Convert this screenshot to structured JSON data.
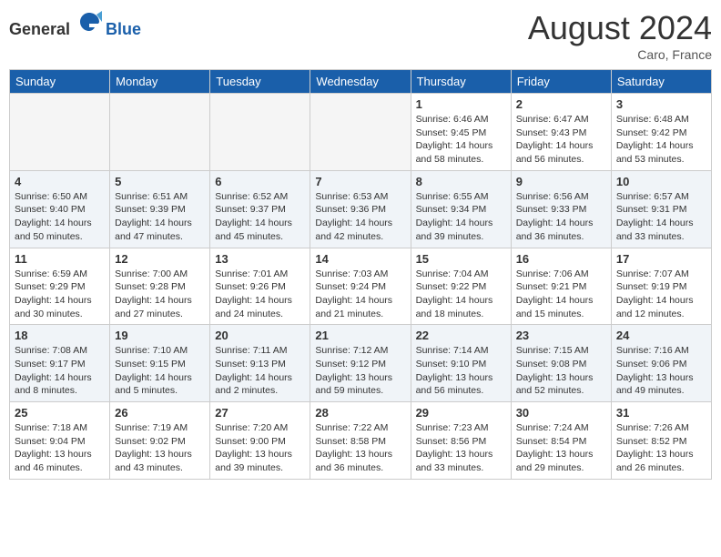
{
  "header": {
    "logo_general": "General",
    "logo_blue": "Blue",
    "month_year": "August 2024",
    "location": "Caro, France"
  },
  "days_of_week": [
    "Sunday",
    "Monday",
    "Tuesday",
    "Wednesday",
    "Thursday",
    "Friday",
    "Saturday"
  ],
  "weeks": [
    [
      {
        "day": "",
        "info": ""
      },
      {
        "day": "",
        "info": ""
      },
      {
        "day": "",
        "info": ""
      },
      {
        "day": "",
        "info": ""
      },
      {
        "day": "1",
        "info": "Sunrise: 6:46 AM\nSunset: 9:45 PM\nDaylight: 14 hours\nand 58 minutes."
      },
      {
        "day": "2",
        "info": "Sunrise: 6:47 AM\nSunset: 9:43 PM\nDaylight: 14 hours\nand 56 minutes."
      },
      {
        "day": "3",
        "info": "Sunrise: 6:48 AM\nSunset: 9:42 PM\nDaylight: 14 hours\nand 53 minutes."
      }
    ],
    [
      {
        "day": "4",
        "info": "Sunrise: 6:50 AM\nSunset: 9:40 PM\nDaylight: 14 hours\nand 50 minutes."
      },
      {
        "day": "5",
        "info": "Sunrise: 6:51 AM\nSunset: 9:39 PM\nDaylight: 14 hours\nand 47 minutes."
      },
      {
        "day": "6",
        "info": "Sunrise: 6:52 AM\nSunset: 9:37 PM\nDaylight: 14 hours\nand 45 minutes."
      },
      {
        "day": "7",
        "info": "Sunrise: 6:53 AM\nSunset: 9:36 PM\nDaylight: 14 hours\nand 42 minutes."
      },
      {
        "day": "8",
        "info": "Sunrise: 6:55 AM\nSunset: 9:34 PM\nDaylight: 14 hours\nand 39 minutes."
      },
      {
        "day": "9",
        "info": "Sunrise: 6:56 AM\nSunset: 9:33 PM\nDaylight: 14 hours\nand 36 minutes."
      },
      {
        "day": "10",
        "info": "Sunrise: 6:57 AM\nSunset: 9:31 PM\nDaylight: 14 hours\nand 33 minutes."
      }
    ],
    [
      {
        "day": "11",
        "info": "Sunrise: 6:59 AM\nSunset: 9:29 PM\nDaylight: 14 hours\nand 30 minutes."
      },
      {
        "day": "12",
        "info": "Sunrise: 7:00 AM\nSunset: 9:28 PM\nDaylight: 14 hours\nand 27 minutes."
      },
      {
        "day": "13",
        "info": "Sunrise: 7:01 AM\nSunset: 9:26 PM\nDaylight: 14 hours\nand 24 minutes."
      },
      {
        "day": "14",
        "info": "Sunrise: 7:03 AM\nSunset: 9:24 PM\nDaylight: 14 hours\nand 21 minutes."
      },
      {
        "day": "15",
        "info": "Sunrise: 7:04 AM\nSunset: 9:22 PM\nDaylight: 14 hours\nand 18 minutes."
      },
      {
        "day": "16",
        "info": "Sunrise: 7:06 AM\nSunset: 9:21 PM\nDaylight: 14 hours\nand 15 minutes."
      },
      {
        "day": "17",
        "info": "Sunrise: 7:07 AM\nSunset: 9:19 PM\nDaylight: 14 hours\nand 12 minutes."
      }
    ],
    [
      {
        "day": "18",
        "info": "Sunrise: 7:08 AM\nSunset: 9:17 PM\nDaylight: 14 hours\nand 8 minutes."
      },
      {
        "day": "19",
        "info": "Sunrise: 7:10 AM\nSunset: 9:15 PM\nDaylight: 14 hours\nand 5 minutes."
      },
      {
        "day": "20",
        "info": "Sunrise: 7:11 AM\nSunset: 9:13 PM\nDaylight: 14 hours\nand 2 minutes."
      },
      {
        "day": "21",
        "info": "Sunrise: 7:12 AM\nSunset: 9:12 PM\nDaylight: 13 hours\nand 59 minutes."
      },
      {
        "day": "22",
        "info": "Sunrise: 7:14 AM\nSunset: 9:10 PM\nDaylight: 13 hours\nand 56 minutes."
      },
      {
        "day": "23",
        "info": "Sunrise: 7:15 AM\nSunset: 9:08 PM\nDaylight: 13 hours\nand 52 minutes."
      },
      {
        "day": "24",
        "info": "Sunrise: 7:16 AM\nSunset: 9:06 PM\nDaylight: 13 hours\nand 49 minutes."
      }
    ],
    [
      {
        "day": "25",
        "info": "Sunrise: 7:18 AM\nSunset: 9:04 PM\nDaylight: 13 hours\nand 46 minutes."
      },
      {
        "day": "26",
        "info": "Sunrise: 7:19 AM\nSunset: 9:02 PM\nDaylight: 13 hours\nand 43 minutes."
      },
      {
        "day": "27",
        "info": "Sunrise: 7:20 AM\nSunset: 9:00 PM\nDaylight: 13 hours\nand 39 minutes."
      },
      {
        "day": "28",
        "info": "Sunrise: 7:22 AM\nSunset: 8:58 PM\nDaylight: 13 hours\nand 36 minutes."
      },
      {
        "day": "29",
        "info": "Sunrise: 7:23 AM\nSunset: 8:56 PM\nDaylight: 13 hours\nand 33 minutes."
      },
      {
        "day": "30",
        "info": "Sunrise: 7:24 AM\nSunset: 8:54 PM\nDaylight: 13 hours\nand 29 minutes."
      },
      {
        "day": "31",
        "info": "Sunrise: 7:26 AM\nSunset: 8:52 PM\nDaylight: 13 hours\nand 26 minutes."
      }
    ]
  ]
}
